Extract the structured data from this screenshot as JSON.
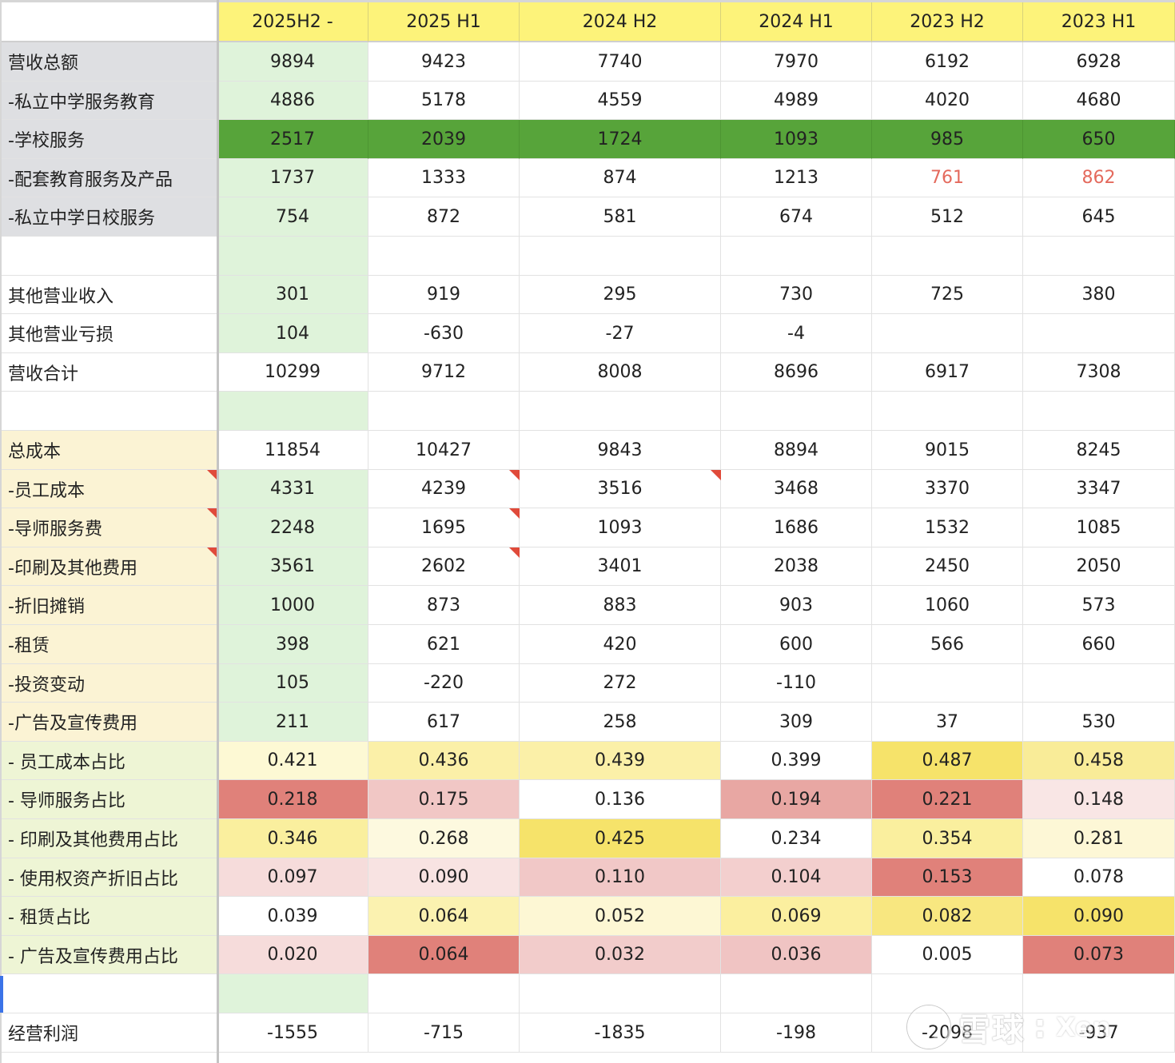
{
  "colors": {
    "header_yellow": "#fdf37a",
    "label_gray": "#dedfe2",
    "label_cream": "#fbf3d4",
    "label_lime": "#eef5d5",
    "pale_green": "#dff3da",
    "strong_green": "#57a43a",
    "red_text": "#e46a5d"
  },
  "sheet": {
    "columns": [
      "",
      "2025H2 -",
      "2025 H1",
      "2024 H2",
      "2024 H1",
      "2023 H2",
      "2023 H1"
    ],
    "rows": [
      {
        "label": "营收总额",
        "values": [
          "9894",
          "9423",
          "7740",
          "7970",
          "6192",
          "6928"
        ],
        "label_bg": "#dedfe2"
      },
      {
        "label": "-私立中学服务教育",
        "values": [
          "4886",
          "5178",
          "4559",
          "4989",
          "4020",
          "4680"
        ],
        "label_bg": "#dedfe2"
      },
      {
        "label": "-学校服务",
        "values": [
          "2517",
          "2039",
          "1724",
          "1093",
          "985",
          "650"
        ],
        "label_bg": "#dedfe2",
        "row_bg": "#57a43a"
      },
      {
        "label": "-配套教育服务及产品",
        "values": [
          "1737",
          "1333",
          "874",
          "1213",
          "761",
          "862"
        ],
        "label_bg": "#dedfe2",
        "text_colors": [
          null,
          null,
          null,
          null,
          "#e46a5d",
          "#e46a5d"
        ]
      },
      {
        "label": "-私立中学日校服务",
        "values": [
          "754",
          "872",
          "581",
          "674",
          "512",
          "645"
        ],
        "label_bg": "#dedfe2"
      },
      {
        "label": "",
        "values": [
          "",
          "",
          "",
          "",
          "",
          ""
        ]
      },
      {
        "label": "其他营业收入",
        "values": [
          "301",
          "919",
          "295",
          "730",
          "725",
          "380"
        ]
      },
      {
        "label": "其他营业亏损",
        "values": [
          "104",
          "-630",
          "-27",
          "-4",
          "",
          ""
        ]
      },
      {
        "label": "营收合计",
        "values": [
          "10299",
          "9712",
          "8008",
          "8696",
          "6917",
          "7308"
        ],
        "first_white": true
      },
      {
        "label": "",
        "values": [
          "",
          "",
          "",
          "",
          "",
          ""
        ]
      },
      {
        "label": "总成本",
        "values": [
          "11854",
          "10427",
          "9843",
          "8894",
          "9015",
          "8245"
        ],
        "label_bg": "#fbf3d4",
        "first_white": true
      },
      {
        "label": "-员工成本",
        "values": [
          "4331",
          "4239",
          "3516",
          "3468",
          "3370",
          "3347"
        ],
        "label_bg": "#fbf3d4",
        "notes": [
          0,
          2,
          3
        ]
      },
      {
        "label": "-导师服务费",
        "values": [
          "2248",
          "1695",
          "1093",
          "1686",
          "1532",
          "1085"
        ],
        "label_bg": "#fbf3d4",
        "notes": [
          0,
          2
        ]
      },
      {
        "label": "-印刷及其他费用",
        "values": [
          "3561",
          "2602",
          "3401",
          "2038",
          "2450",
          "2050"
        ],
        "label_bg": "#fbf3d4",
        "notes": [
          0,
          2
        ]
      },
      {
        "label": "-折旧摊销",
        "values": [
          "1000",
          "873",
          "883",
          "903",
          "1060",
          "573"
        ],
        "label_bg": "#fbf3d4"
      },
      {
        "label": "-租赁",
        "values": [
          "398",
          "621",
          "420",
          "600",
          "566",
          "660"
        ],
        "label_bg": "#fbf3d4"
      },
      {
        "label": "-投资变动",
        "values": [
          "105",
          "-220",
          "272",
          "-110",
          "",
          ""
        ],
        "label_bg": "#fbf3d4"
      },
      {
        "label": "-广告及宣传费用",
        "values": [
          "211",
          "617",
          "258",
          "309",
          "37",
          "530"
        ],
        "label_bg": "#fbf3d4"
      },
      {
        "label": "- 员工成本占比",
        "values": [
          "0.421",
          "0.436",
          "0.439",
          "0.399",
          "0.487",
          "0.458"
        ],
        "label_bg": "#eef5d5",
        "bgs": [
          "#fdf9d4",
          "#fbf0a8",
          "#fbf0a8",
          "#ffffff",
          "#f6e36a",
          "#f9ec98"
        ]
      },
      {
        "label": "- 导师服务占比",
        "values": [
          "0.218",
          "0.175",
          "0.136",
          "0.194",
          "0.221",
          "0.148"
        ],
        "label_bg": "#eef5d5",
        "bgs": [
          "#e0817a",
          "#f1c7c5",
          "#ffffff",
          "#e8a7a3",
          "#e0817a",
          "#f9e6e5"
        ]
      },
      {
        "label": "- 印刷及其他费用占比",
        "values": [
          "0.346",
          "0.268",
          "0.425",
          "0.234",
          "0.354",
          "0.281"
        ],
        "label_bg": "#eef5d5",
        "bgs": [
          "#faef9e",
          "#fdf9df",
          "#f6e36a",
          "#ffffff",
          "#faef9e",
          "#fdf7d6"
        ]
      },
      {
        "label": "- 使用权资产折旧占比",
        "values": [
          "0.097",
          "0.090",
          "0.110",
          "0.104",
          "0.153",
          "0.078"
        ],
        "label_bg": "#eef5d5",
        "bgs": [
          "#f6dcdb",
          "#f8e3e2",
          "#f1c8c7",
          "#f3cfce",
          "#e0817a",
          "#ffffff"
        ]
      },
      {
        "label": "- 租赁占比",
        "values": [
          "0.039",
          "0.064",
          "0.052",
          "0.069",
          "0.082",
          "0.090"
        ],
        "label_bg": "#eef5d5",
        "bgs": [
          "#ffffff",
          "#fbf2b0",
          "#fdf7d4",
          "#fbef9f",
          "#f8e780",
          "#f6e36a"
        ]
      },
      {
        "label": "- 广告及宣传费用占比",
        "values": [
          "0.020",
          "0.064",
          "0.032",
          "0.036",
          "0.005",
          "0.073"
        ],
        "label_bg": "#eef5d5",
        "bgs": [
          "#f6dcdb",
          "#e0817a",
          "#f2cccb",
          "#f0c4c3",
          "#ffffff",
          "#e0817a"
        ]
      },
      {
        "label": "",
        "values": [
          "",
          "",
          "",
          "",
          "",
          ""
        ]
      },
      {
        "label": "经营利润",
        "values": [
          "-1555",
          "-715",
          "-1835",
          "-198",
          "-2098",
          "-937"
        ],
        "first_white": true
      }
    ]
  },
  "watermark": {
    "brand": "雪球",
    "user": "Xen"
  }
}
